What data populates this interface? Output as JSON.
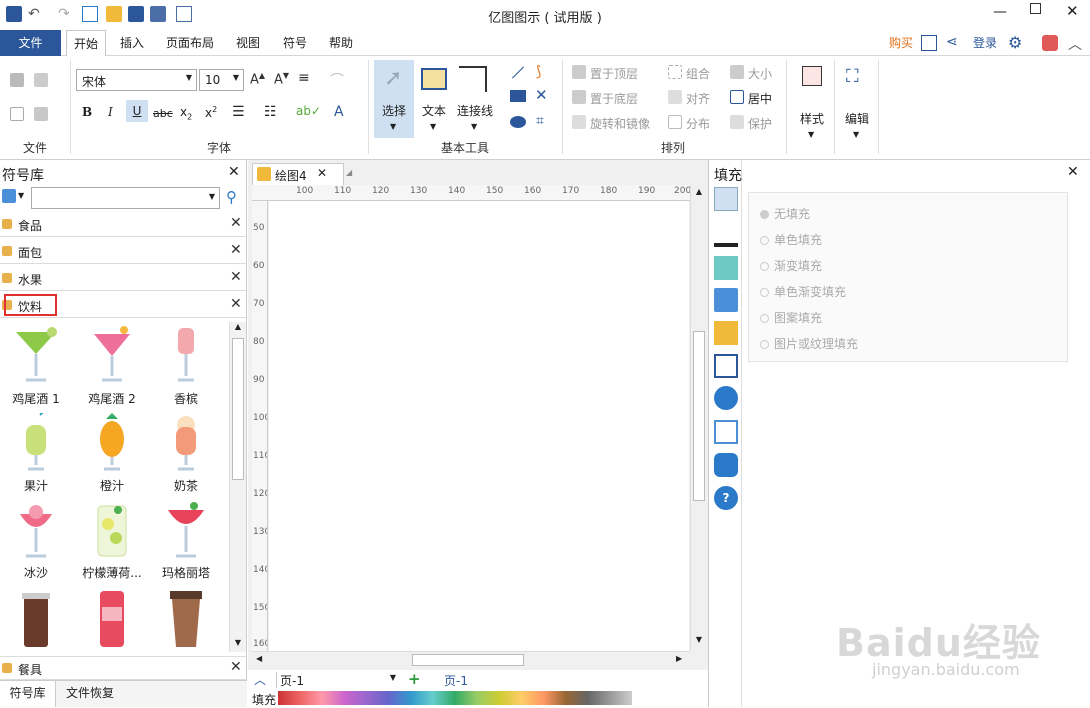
{
  "title": "亿图图示 ( 试用版 )",
  "menu": {
    "file": "文件",
    "tabs": [
      "开始",
      "插入",
      "页面布局",
      "视图",
      "符号",
      "帮助"
    ],
    "buy": "购买",
    "login": "登录"
  },
  "ribbon": {
    "font_name": "宋体",
    "font_size": "10",
    "select": "选择",
    "text": "文本",
    "connector": "连接线",
    "bring_top": "置于顶层",
    "send_bottom": "置于底层",
    "rotate": "旋转和镜像",
    "group": "组合",
    "align": "对齐",
    "distribute": "分布",
    "size": "大小",
    "center": "居中",
    "protect": "保护",
    "style": "样式",
    "edit": "编辑",
    "groups": [
      "文件",
      "字体",
      "基本工具",
      "排列"
    ]
  },
  "library": {
    "title": "符号库",
    "categories": [
      "食品",
      "面包",
      "水果",
      "饮料"
    ],
    "bottom_category": "餐具",
    "symbols": [
      "鸡尾酒 1",
      "鸡尾酒 2",
      "香槟",
      "果汁",
      "橙汁",
      "奶茶",
      "冰沙",
      "柠檬薄荷...",
      "玛格丽塔"
    ],
    "tabs": [
      "符号库",
      "文件恢复"
    ]
  },
  "document": {
    "tab": "绘图4",
    "page": "页-1",
    "page_tab": "页-1"
  },
  "ruler": {
    "h": [
      "100",
      "110",
      "120",
      "130",
      "140",
      "150",
      "160",
      "170",
      "180",
      "190",
      "200"
    ],
    "v": [
      "50",
      "60",
      "70",
      "80",
      "90",
      "100",
      "110",
      "120",
      "130",
      "140",
      "150",
      "160"
    ]
  },
  "fill": {
    "title": "填充",
    "options": [
      "无填充",
      "单色填充",
      "渐变填充",
      "单色渐变填充",
      "图案填充",
      "图片或纹理填充"
    ],
    "bottom_label": "填充"
  },
  "watermark": {
    "brand": "Baidu经验",
    "url": "jingyan.baidu.com"
  },
  "colors": {
    "accent": "#2b579a",
    "active_tab_border": "#c00000",
    "select_bg": "#cfe0f3"
  }
}
